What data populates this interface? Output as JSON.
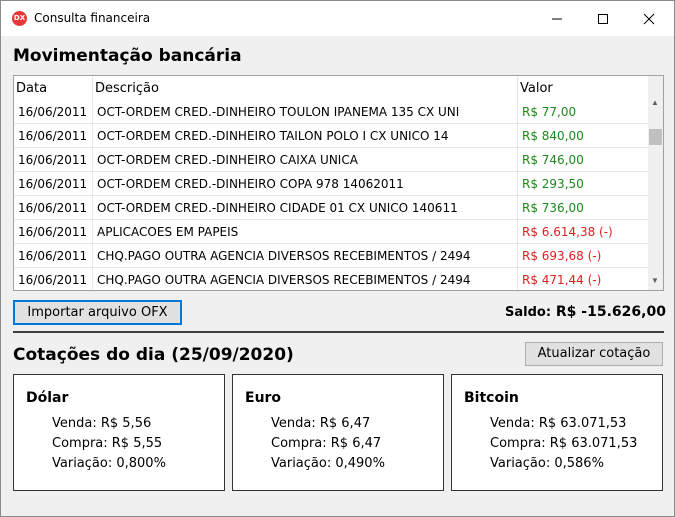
{
  "window": {
    "title": "Consulta financeira",
    "icon_text": "DX"
  },
  "movimentacao": {
    "heading": "Movimentação bancária",
    "columns": [
      "Data",
      "Descrição",
      "Valor"
    ],
    "rows": [
      {
        "data": "16/06/2011",
        "descricao": "OCT-ORDEM CRED.-DINHEIRO TOULON IPANEMA 135 CX UNI",
        "valor": "R$ 77,00",
        "tipo": "pos"
      },
      {
        "data": "16/06/2011",
        "descricao": "OCT-ORDEM CRED.-DINHEIRO TAILON POLO I CX UNICO 14",
        "valor": "R$ 840,00",
        "tipo": "pos"
      },
      {
        "data": "16/06/2011",
        "descricao": "OCT-ORDEM CRED.-DINHEIRO CAIXA UNICA",
        "valor": "R$ 746,00",
        "tipo": "pos"
      },
      {
        "data": "16/06/2011",
        "descricao": "OCT-ORDEM CRED.-DINHEIRO COPA 978 14062011",
        "valor": "R$ 293,50",
        "tipo": "pos"
      },
      {
        "data": "16/06/2011",
        "descricao": "OCT-ORDEM CRED.-DINHEIRO CIDADE 01 CX UNICO 140611",
        "valor": "R$ 736,00",
        "tipo": "pos"
      },
      {
        "data": "16/06/2011",
        "descricao": "APLICACOES EM PAPEIS",
        "valor": "R$ 6.614,38 (-)",
        "tipo": "neg"
      },
      {
        "data": "16/06/2011",
        "descricao": "CHQ.PAGO OUTRA AGENCIA DIVERSOS RECEBIMENTOS / 2494",
        "valor": "R$ 693,68 (-)",
        "tipo": "neg"
      },
      {
        "data": "16/06/2011",
        "descricao": "CHQ.PAGO OUTRA AGENCIA DIVERSOS RECEBIMENTOS / 2494",
        "valor": "R$ 471,44 (-)",
        "tipo": "neg"
      }
    ],
    "import_button": "Importar arquivo OFX",
    "saldo_label": "Saldo:",
    "saldo_value": "R$ -15.626,00"
  },
  "cotacoes": {
    "heading": "Cotações do dia (25/09/2020)",
    "update_button": "Atualizar cotação",
    "cards": [
      {
        "name": "Dólar",
        "venda": "Venda: R$ 5,56",
        "compra": "Compra: R$ 5,55",
        "variacao": "Variação: 0,800%"
      },
      {
        "name": "Euro",
        "venda": "Venda: R$ 6,47",
        "compra": "Compra: R$ 6,47",
        "variacao": "Variação: 0,490%"
      },
      {
        "name": "Bitcoin",
        "venda": "Venda: R$ 63.071,53",
        "compra": "Compra: R$ 63.071,53",
        "variacao": "Variação: 0,586%"
      }
    ]
  },
  "colors": {
    "positive": "#1a8a1a",
    "negative": "#e02020",
    "focus": "#0078d7"
  },
  "icons": [
    "app-icon",
    "minimize-icon",
    "maximize-icon",
    "close-icon",
    "scroll-up-icon",
    "scroll-down-icon"
  ]
}
